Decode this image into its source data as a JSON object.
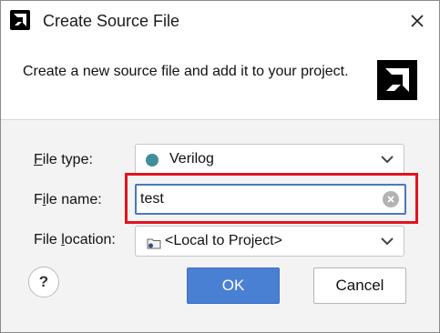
{
  "dialog": {
    "title": "Create Source File",
    "description": "Create a new source file and add it to your project."
  },
  "form": {
    "file_type": {
      "label_underlined": "F",
      "label_rest": "ile type:",
      "value": "Verilog",
      "icon": "verilog-dot-icon",
      "icon_color": "#3f8e9e"
    },
    "file_name": {
      "label_pre": "F",
      "label_underlined": "i",
      "label_rest": "le name:",
      "value": "test"
    },
    "file_location": {
      "label_pre": "File ",
      "label_underlined": "l",
      "label_rest": "ocation:",
      "value": "<Local to Project>",
      "icon": "folder-icon"
    }
  },
  "buttons": {
    "help": "?",
    "ok": "OK",
    "cancel": "Cancel"
  },
  "colors": {
    "ok_button": "#4a80d3",
    "highlight": "#e0141e",
    "input_focus": "#4a78c2"
  }
}
